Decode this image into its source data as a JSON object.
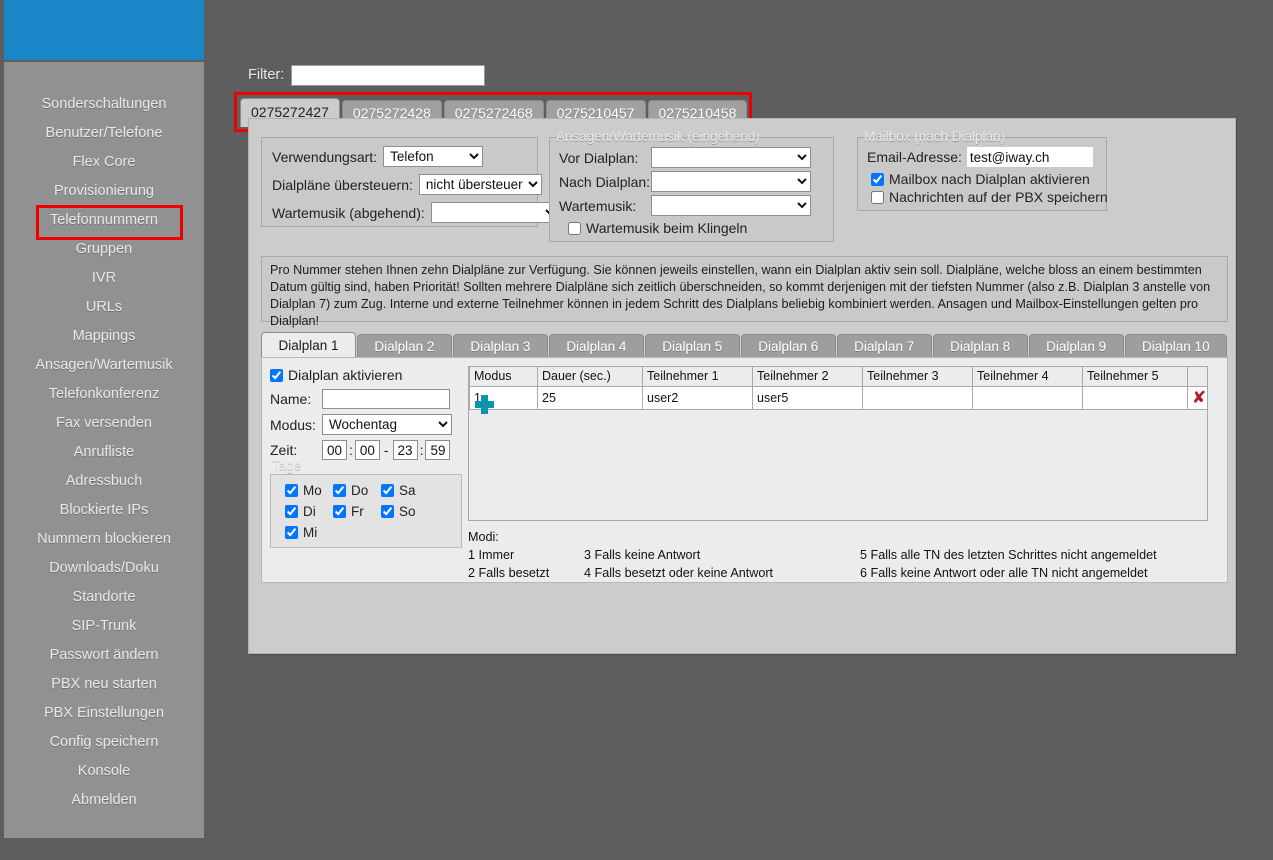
{
  "sidebar": {
    "logo_alt": "brand-logo",
    "accent_color": "#1a87c8",
    "selected_item": "Telefonnummern",
    "items": [
      {
        "label": "Sonderschaltungen"
      },
      {
        "label": "Benutzer/Telefone"
      },
      {
        "label": "Flex Core"
      },
      {
        "label": "Provisionierung"
      },
      {
        "label": "Telefonnummern"
      },
      {
        "label": "Gruppen"
      },
      {
        "label": "IVR"
      },
      {
        "label": "URLs"
      },
      {
        "label": "Mappings"
      },
      {
        "label": "Ansagen/Wartemusik"
      },
      {
        "label": "Telefonkonferenz"
      },
      {
        "label": "Fax versenden"
      },
      {
        "label": "Anrufliste"
      },
      {
        "label": "Adressbuch"
      },
      {
        "label": "Blockierte IPs"
      },
      {
        "label": "Nummern blockieren"
      },
      {
        "label": "Downloads/Doku"
      },
      {
        "label": "Standorte"
      },
      {
        "label": "SIP-Trunk"
      },
      {
        "label": "Passwort ändern"
      },
      {
        "label": "PBX neu starten"
      },
      {
        "label": "PBX Einstellungen"
      },
      {
        "label": "Config speichern"
      },
      {
        "label": "Konsole"
      },
      {
        "label": "Abmelden"
      }
    ]
  },
  "filter": {
    "label": "Filter:",
    "value": "",
    "placeholder": ""
  },
  "number_tabs": {
    "highlight_color": "#ee0000",
    "active_index": 0,
    "items": [
      {
        "label": "0275272427"
      },
      {
        "label": "0275272428"
      },
      {
        "label": "0275272468"
      },
      {
        "label": "0275210457"
      },
      {
        "label": "0275210458"
      }
    ]
  },
  "usage": {
    "verwendungsart_label": "Verwendungsart:",
    "verwendungsart_value": "Telefon",
    "dialplaene_label": "Dialpläne übersteuern:",
    "dialplaene_value": "nicht übersteuern",
    "wartemusik_label": "Wartemusik (abgehend):",
    "wartemusik_value": ""
  },
  "announcements": {
    "legend": "Ansagen/Wartemusik (eingehend)",
    "vor_dialplan_label": "Vor Dialplan:",
    "vor_dialplan_value": "",
    "nach_dialplan_label": "Nach Dialplan:",
    "nach_dialplan_value": "",
    "wartemusik_label": "Wartemusik:",
    "wartemusik_value": "",
    "klingeln_label": "Wartemusik beim Klingeln",
    "klingeln_checked": false
  },
  "mailbox": {
    "legend": "Mailbox (nach Dialplan)",
    "email_label": "Email-Adresse:",
    "email_value": "test@iway.ch",
    "aktivieren_label": "Mailbox nach Dialplan aktivieren",
    "aktivieren_checked": true,
    "speichern_label": "Nachrichten auf der PBX speichern",
    "speichern_checked": false
  },
  "info": {
    "text": "Pro Nummer stehen Ihnen zehn Dialpläne zur Verfügung. Sie können jeweils einstellen, wann ein Dialplan aktiv sein soll. Dialpläne, welche bloss an einem bestimmten Datum gültig sind, haben Priorität! Sollten mehrere Dialpläne sich zeitlich überschneiden, so kommt derjenigen mit der tiefsten Nummer (also z.B. Dialplan 3 anstelle von Dialplan 7) zum Zug. Interne und externe Teilnehmer können in jedem Schritt des Dialplans beliebig kombiniert werden. Ansagen und Mailbox-Einstellungen gelten pro Dialplan!"
  },
  "dialplan_tabs": {
    "active_index": 0,
    "items": [
      {
        "label": "Dialplan 1"
      },
      {
        "label": "Dialplan 2"
      },
      {
        "label": "Dialplan 3"
      },
      {
        "label": "Dialplan 4"
      },
      {
        "label": "Dialplan 5"
      },
      {
        "label": "Dialplan 6"
      },
      {
        "label": "Dialplan 7"
      },
      {
        "label": "Dialplan 8"
      },
      {
        "label": "Dialplan 9"
      },
      {
        "label": "Dialplan 10"
      }
    ]
  },
  "dialplan_form": {
    "activate_label": "Dialplan aktivieren",
    "activate_checked": true,
    "name_label": "Name:",
    "name_value": "",
    "modus_label": "Modus:",
    "modus_value": "Wochentag",
    "zeit_label": "Zeit:",
    "zeit_from_h": "00",
    "zeit_from_m": "00",
    "zeit_sep": "-",
    "zeit_to_h": "23",
    "zeit_to_m": "59",
    "tage_legend": "Tage",
    "days": [
      {
        "label": "Mo",
        "checked": true
      },
      {
        "label": "Do",
        "checked": true
      },
      {
        "label": "Sa",
        "checked": true
      },
      {
        "label": "Di",
        "checked": true
      },
      {
        "label": "Fr",
        "checked": true
      },
      {
        "label": "So",
        "checked": true
      },
      {
        "label": "Mi",
        "checked": true
      }
    ]
  },
  "dialplan_table": {
    "headers": [
      "Modus",
      "Dauer (sec.)",
      "Teilnehmer 1",
      "Teilnehmer 2",
      "Teilnehmer 3",
      "Teilnehmer 4",
      "Teilnehmer 5",
      ""
    ],
    "rows": [
      {
        "modus": "1",
        "dauer": "25",
        "tn1": "user2",
        "tn2": "user5",
        "tn3": "",
        "tn4": "",
        "tn5": "",
        "delete_icon": "✘"
      }
    ],
    "add_icon": "plus-icon"
  },
  "modi": {
    "title": "Modi:",
    "entries": [
      {
        "num": "1",
        "text": "Immer"
      },
      {
        "num": "2",
        "text": "Falls besetzt"
      },
      {
        "num": "3",
        "text": "Falls keine Antwort"
      },
      {
        "num": "4",
        "text": "Falls besetzt oder keine Antwort"
      },
      {
        "num": "5",
        "text": "Falls alle TN des letzten Schrittes nicht angemeldet"
      },
      {
        "num": "6",
        "text": "Falls keine Antwort oder alle TN nicht angemeldet"
      }
    ]
  }
}
